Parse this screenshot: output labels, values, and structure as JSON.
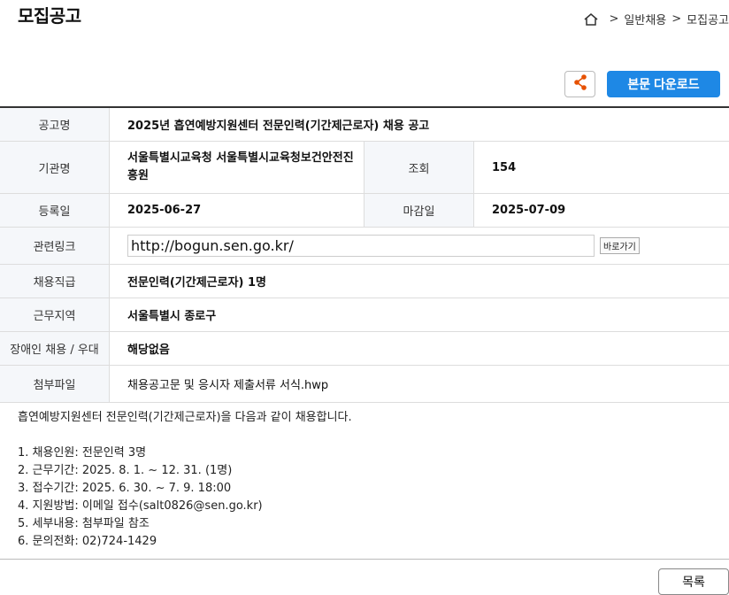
{
  "page": {
    "title": "모집공고"
  },
  "breadcrumb": {
    "sep1": ">",
    "item1": "일반채용",
    "sep2": ">",
    "item2": "모집공고"
  },
  "actions": {
    "download_label": "본문 다운로드"
  },
  "info": {
    "title_label": "공고명",
    "title_value": "2025년 흡연예방지원센터 전문인력(기간제근로자) 채용 공고",
    "org_label": "기관명",
    "org_value": "서울특별시교육청 서울특별시교육청보건안전진흥원",
    "views_label": "조회",
    "views_value": "154",
    "reg_label": "등록일",
    "reg_value": "2025-06-27",
    "deadline_label": "마감일",
    "deadline_value": "2025-07-09",
    "link_label": "관련링크",
    "link_value": "http://bogun.sen.go.kr/",
    "goto_label": "바로가기",
    "position_label": "채용직급",
    "position_value": "전문인력(기간제근로자) 1명",
    "region_label": "근무지역",
    "region_value": "서울특별시 종로구",
    "disabled_label": "장애인 채용 / 우대",
    "disabled_value": "해당없음",
    "attach_label": "첨부파일",
    "attach_value": "채용공고문 및 응시자 제출서류 서식.hwp"
  },
  "body": {
    "intro": "흡연예방지원센터 전문인력(기간제근로자)을 다음과 같이 채용합니다.",
    "items": [
      "1. 채용인원: 전문인력 3명",
      "2. 근무기간: 2025. 8. 1. ~ 12. 31. (1명)",
      "3. 접수기간: 2025. 6. 30. ~ 7. 9. 18:00",
      "4. 지원방법: 이메일 접수(salt0826@sen.go.kr)",
      "5. 세부내용: 첨부파일 참조",
      "6. 문의전화: 02)724-1429"
    ]
  },
  "footer": {
    "list_label": "목록"
  },
  "colors": {
    "accent": "#1e88e5",
    "share_icon": "#e65100"
  }
}
